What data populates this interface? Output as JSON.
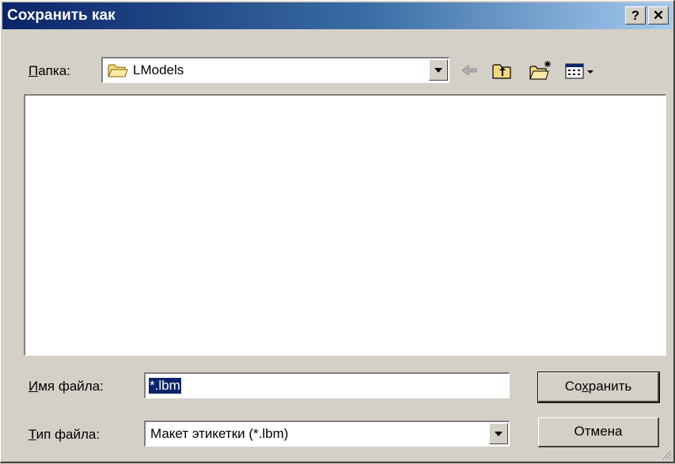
{
  "window": {
    "title": "Сохранить как",
    "help_label": "?",
    "close_label": "✕"
  },
  "folder": {
    "label_hot": "П",
    "label_rest": "апка:",
    "value": "LModels"
  },
  "file_list": {
    "items": []
  },
  "filename": {
    "label_hot": "И",
    "label_rest": "мя файла:",
    "value": "*.lbm"
  },
  "filetype": {
    "label_hot": "Т",
    "label_rest": "ип файла:",
    "value": "Макет этикетки (*.lbm)"
  },
  "buttons": {
    "save_pre": "Со",
    "save_hot": "х",
    "save_post": "ранить",
    "cancel": "Отмена"
  },
  "icons": {
    "folder": "folder-icon",
    "back": "back-arrow-icon",
    "up": "up-one-level-icon",
    "new_folder": "new-folder-icon",
    "view": "view-menu-icon"
  },
  "colors": {
    "titlebar_start": "#0a246a",
    "titlebar_end": "#a6caf0",
    "face": "#d4d0c8",
    "selection": "#0a246a"
  }
}
